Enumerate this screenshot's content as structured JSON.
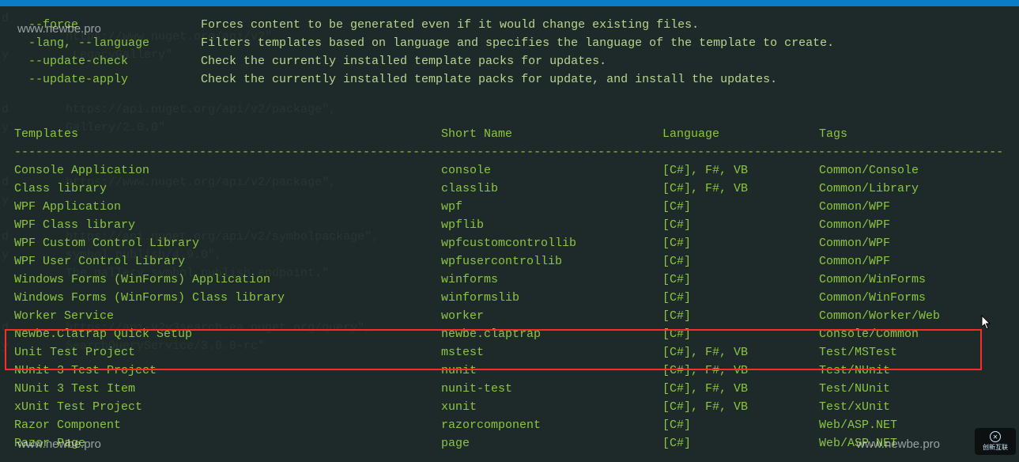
{
  "options": [
    {
      "name": "  --force",
      "desc": "Forces content to be generated even if it would change existing files."
    },
    {
      "name": "  -lang, --language",
      "desc": "Filters templates based on language and specifies the language of the template to create."
    },
    {
      "name": "  --update-check",
      "desc": "Check the currently installed template packs for updates."
    },
    {
      "name": "  --update-apply",
      "desc": "Check the currently installed template packs for update, and install the updates."
    }
  ],
  "headers": {
    "templates": "Templates",
    "short": "Short Name",
    "lang": "Language",
    "tags": "Tags"
  },
  "divider": "--------------------------------------------------------------------------------------------------------------------------------------------------",
  "rows": [
    {
      "t": "Console Application",
      "s": "console",
      "l": "[C#], F#, VB",
      "g": "Common/Console"
    },
    {
      "t": "Class library",
      "s": "classlib",
      "l": "[C#], F#, VB",
      "g": "Common/Library"
    },
    {
      "t": "WPF Application",
      "s": "wpf",
      "l": "[C#]",
      "g": "Common/WPF"
    },
    {
      "t": "WPF Class library",
      "s": "wpflib",
      "l": "[C#]",
      "g": "Common/WPF"
    },
    {
      "t": "WPF Custom Control Library",
      "s": "wpfcustomcontrollib",
      "l": "[C#]",
      "g": "Common/WPF"
    },
    {
      "t": "WPF User Control Library",
      "s": "wpfusercontrollib",
      "l": "[C#]",
      "g": "Common/WPF"
    },
    {
      "t": "Windows Forms (WinForms) Application",
      "s": "winforms",
      "l": "[C#]",
      "g": "Common/WinForms"
    },
    {
      "t": "Windows Forms (WinForms) Class library",
      "s": "winformslib",
      "l": "[C#]",
      "g": "Common/WinForms"
    },
    {
      "t": "Worker Service",
      "s": "worker",
      "l": "[C#]",
      "g": "Common/Worker/Web"
    },
    {
      "t": "Newbe.Clatrap Quick Setup",
      "s": "newbe.claptrap",
      "l": "[C#]",
      "g": "Console/Common"
    },
    {
      "t": "Unit Test Project",
      "s": "mstest",
      "l": "[C#], F#, VB",
      "g": "Test/MSTest"
    },
    {
      "t": "NUnit 3 Test Project",
      "s": "nunit",
      "l": "[C#], F#, VB",
      "g": "Test/NUnit"
    },
    {
      "t": "NUnit 3 Test Item",
      "s": "nunit-test",
      "l": "[C#], F#, VB",
      "g": "Test/NUnit"
    },
    {
      "t": "xUnit Test Project",
      "s": "xunit",
      "l": "[C#], F#, VB",
      "g": "Test/xUnit"
    },
    {
      "t": "Razor Component",
      "s": "razorcomponent",
      "l": "[C#]",
      "g": "Web/ASP.NET"
    },
    {
      "t": "Razor Page",
      "s": "page",
      "l": "[C#]",
      "g": "Web/ASP.NET"
    }
  ],
  "watermark": "www.newbe.pro",
  "logo_text": "创新互联",
  "ghost": "d\n        \"https://www.nuget.org/api/v2\",\ny         LegacyGallery\"\n\n\nd        https://api.nuget.org/api/v2/package\",\ny        Gallery/2.0.0\"\n\n\nd        https://www.nuget.org/api/v2/package\",\ny\n\nd        https://api.nuget.org/api/v2/symbolpackage\",\ny        symbol publish/4.9.0\",\n         The gallery symbol publish endpoint.\"\n\n\nd        https://api-v2v3search-ea.nuget.org/query\",\ny        SearchQueryService/3.0.0-rc\""
}
